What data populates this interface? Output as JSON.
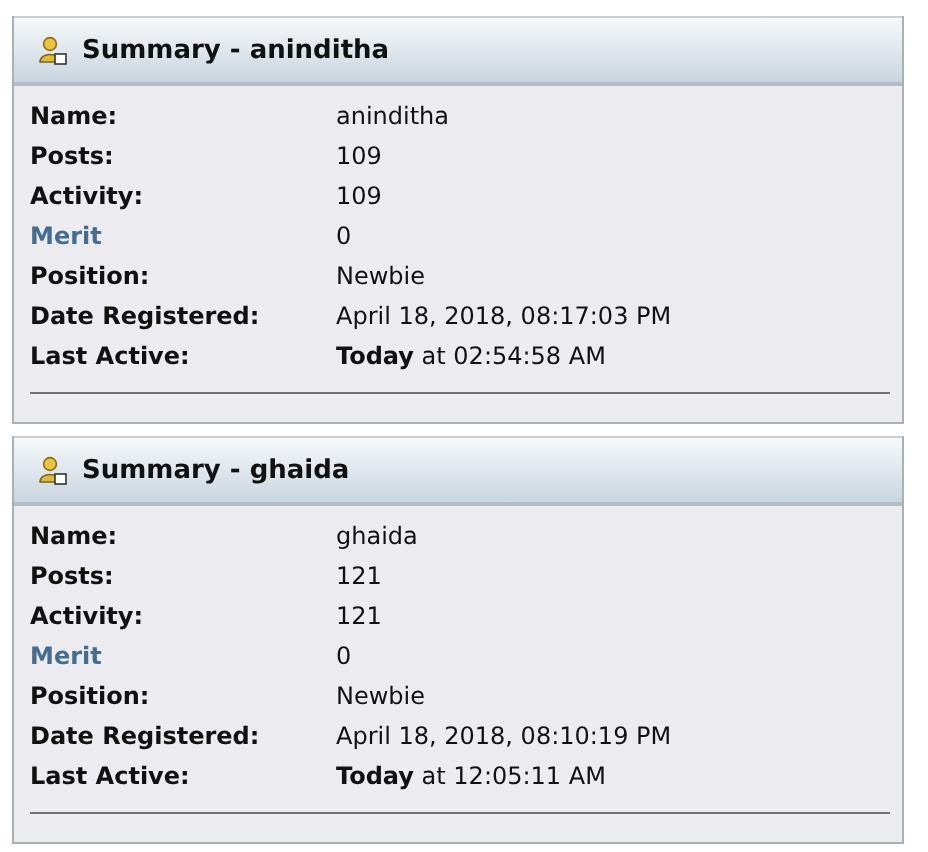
{
  "panels": [
    {
      "title": "Summary - aninditha",
      "rows": [
        {
          "label": "Name:",
          "value": "aninditha",
          "kind": "plain"
        },
        {
          "label": "Posts:",
          "value": "109",
          "kind": "plain"
        },
        {
          "label": "Activity:",
          "value": "109",
          "kind": "plain"
        },
        {
          "label": "Merit",
          "value": "0",
          "kind": "link"
        },
        {
          "label": "Position:",
          "value": "Newbie",
          "kind": "plain"
        },
        {
          "label": "Date Registered:",
          "value": "April 18, 2018, 08:17:03 PM",
          "kind": "plain"
        },
        {
          "label": "Last Active:",
          "value": "**Today** at 02:54:58 AM",
          "kind": "plain"
        }
      ]
    },
    {
      "title": "Summary - ghaida",
      "rows": [
        {
          "label": "Name:",
          "value": "ghaida",
          "kind": "plain"
        },
        {
          "label": "Posts:",
          "value": "121",
          "kind": "plain"
        },
        {
          "label": "Activity:",
          "value": "121",
          "kind": "plain"
        },
        {
          "label": "Merit",
          "value": "0",
          "kind": "link"
        },
        {
          "label": "Position:",
          "value": "Newbie",
          "kind": "plain"
        },
        {
          "label": "Date Registered:",
          "value": "April 18, 2018, 08:10:19 PM",
          "kind": "plain"
        },
        {
          "label": "Last Active:",
          "value": "**Today** at 12:05:11 AM",
          "kind": "plain"
        }
      ]
    }
  ]
}
